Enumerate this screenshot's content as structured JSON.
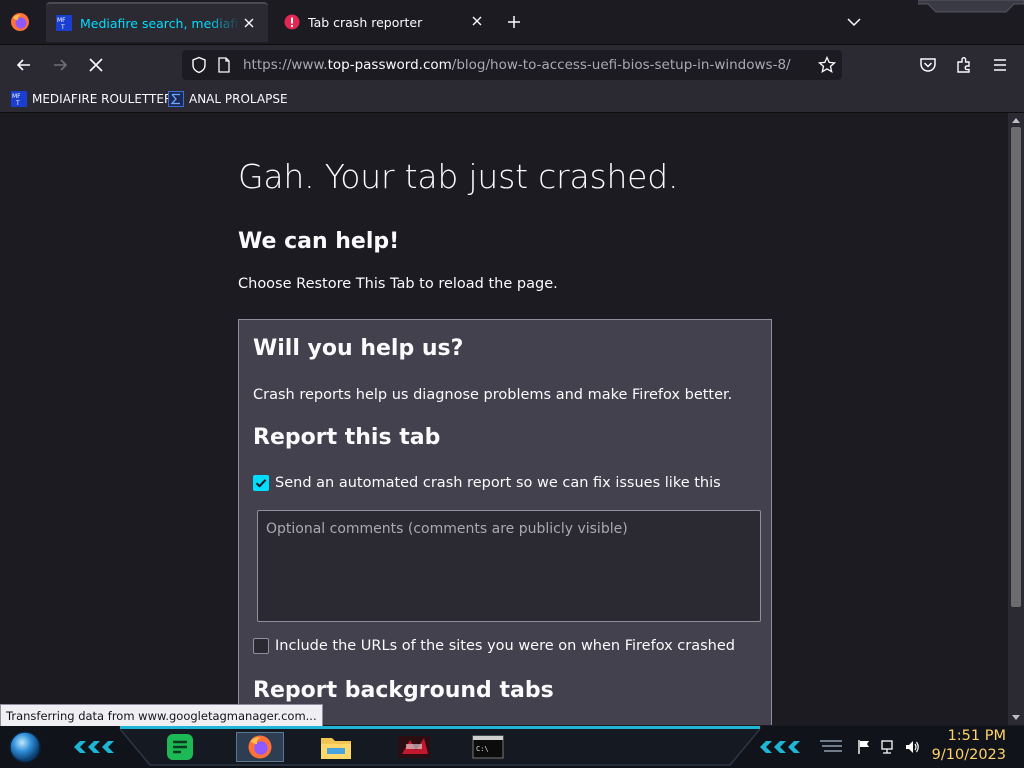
{
  "tabs": [
    {
      "title": "Mediafire search, mediafire search engine",
      "active": true,
      "favicon": "mft-icon"
    },
    {
      "title": "Tab crash reporter",
      "active": false,
      "favicon": "error-icon"
    }
  ],
  "urlbar": {
    "prefix": "https://www.",
    "host": "top-password.com",
    "path": "/blog/how-to-access-uefi-bios-setup-in-windows-8/"
  },
  "bookmarks": [
    {
      "label": "MEDIAFIRE ROULETTER",
      "icon": "mft-icon"
    },
    {
      "label": "ANAL PROLAPSE",
      "icon": "sigma-icon"
    }
  ],
  "crash_page": {
    "title": "Gah. Your tab just crashed.",
    "help_heading": "We can help!",
    "restore_text": "Choose Restore This Tab to reload the page.",
    "help_us_heading": "Will you help us?",
    "help_us_desc": "Crash reports help us diagnose problems and make Firefox better.",
    "report_tab_heading": "Report this tab",
    "send_report_label": "Send an automated crash report so we can fix issues like this",
    "send_report_checked": true,
    "comments_placeholder": "Optional comments (comments are publicly visible)",
    "include_urls_label": "Include the URLs of the sites you were on when Firefox crashed",
    "include_urls_checked": false,
    "report_background_heading": "Report background tabs"
  },
  "status_text": "Transferring data from www.googletagmanager.com...",
  "taskbar": {
    "time": "1:51 PM",
    "date": "9/10/2023",
    "accent": "#1fb5d6",
    "clock_color": "#ffd36b"
  },
  "colors": {
    "accent": "#00ddff",
    "page_bg": "#1c1b22",
    "box_bg": "#42414d"
  }
}
